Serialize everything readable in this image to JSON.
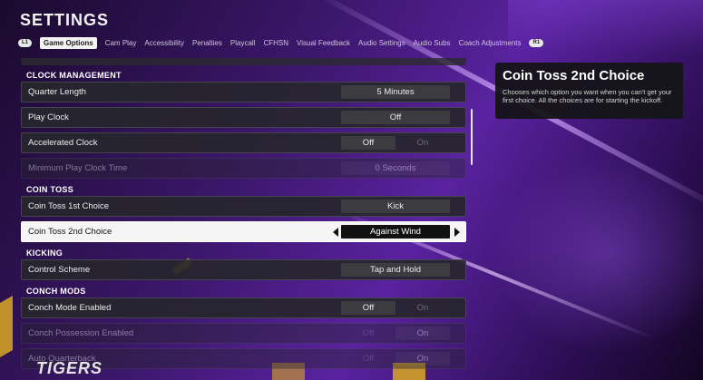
{
  "page": {
    "title": "SETTINGS",
    "tabs": [
      {
        "label": "Game Options",
        "active": true
      },
      {
        "label": "Cam Play"
      },
      {
        "label": "Accessibility"
      },
      {
        "label": "Penalties"
      },
      {
        "label": "Playcall"
      },
      {
        "label": "CFHSN"
      },
      {
        "label": "Visual Feedback"
      },
      {
        "label": "Audio Settings"
      },
      {
        "label": "Audio Subs"
      },
      {
        "label": "Coach Adjustments"
      }
    ],
    "left_hint": "L1",
    "right_hint": "R1"
  },
  "sections": {
    "clock": "CLOCK MANAGEMENT",
    "coin": "COIN TOSS",
    "kicking": "KICKING",
    "conch": "CONCH MODS"
  },
  "rows": {
    "quarter_length": {
      "label": "Quarter Length",
      "value": "5 Minutes"
    },
    "play_clock": {
      "label": "Play Clock",
      "value": "Off"
    },
    "accelerated_clock": {
      "label": "Accelerated Clock",
      "off": "Off",
      "on": "On"
    },
    "min_play_clock": {
      "label": "Minimum Play Clock Time",
      "value": "0 Seconds"
    },
    "coin_toss_1": {
      "label": "Coin Toss 1st Choice",
      "value": "Kick"
    },
    "coin_toss_2": {
      "label": "Coin Toss 2nd Choice",
      "value": "Against Wind"
    },
    "control_scheme": {
      "label": "Control Scheme",
      "value": "Tap and Hold"
    },
    "conch_mode": {
      "label": "Conch Mode Enabled",
      "off": "Off",
      "on": "On"
    },
    "conch_possession": {
      "label": "Conch Possession Enabled",
      "off": "Off",
      "on": "On"
    },
    "auto_qb": {
      "label": "Auto Quarterback",
      "off": "Off",
      "on": "On"
    }
  },
  "help": {
    "title": "Coin Toss 2nd Choice",
    "body": "Chooses which option you want when you can't get your first choice. All the choices are for starting the kickoff."
  },
  "decor": {
    "bottom_text": "TIGERS"
  }
}
